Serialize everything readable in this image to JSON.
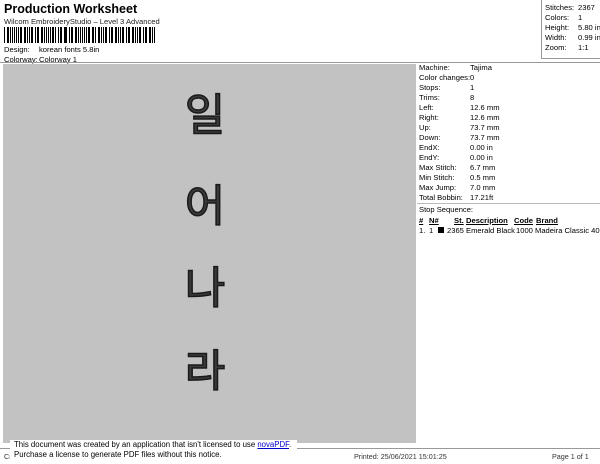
{
  "header": {
    "title": "Production Worksheet",
    "subtitle": "Wilcom EmbroideryStudio – Level 3 Advanced",
    "design_label": "Design:",
    "design_value": "korean fonts 5.8in",
    "colorway_label": "Colorway:",
    "colorway_value": "Colorway 1"
  },
  "stats": [
    {
      "label": "Stitches:",
      "value": "2367"
    },
    {
      "label": "Colors:",
      "value": "1"
    },
    {
      "label": "Height:",
      "value": "5.80 in"
    },
    {
      "label": "Width:",
      "value": "0.99 in"
    },
    {
      "label": "Zoom:",
      "value": "1:1"
    }
  ],
  "design": {
    "characters": [
      "일",
      "어",
      "나",
      "라"
    ],
    "stitch_color": "#1a1a1a",
    "background_color": "#c2c2c2"
  },
  "machine_info": [
    {
      "label": "Machine:",
      "value": "Tajima"
    },
    {
      "label": "Color changes:",
      "value": "0"
    },
    {
      "label": "Stops:",
      "value": "1"
    },
    {
      "label": "Trims:",
      "value": "8"
    },
    {
      "label": "Left:",
      "value": "12.6 mm"
    },
    {
      "label": "Right:",
      "value": "12.6 mm"
    },
    {
      "label": "Up:",
      "value": "73.7 mm"
    },
    {
      "label": "Down:",
      "value": "73.7 mm"
    },
    {
      "label": "EndX:",
      "value": "0.00 in"
    },
    {
      "label": "EndY:",
      "value": "0.00 in"
    },
    {
      "label": "Max Stitch:",
      "value": "6.7 mm"
    },
    {
      "label": "Min Stitch:",
      "value": "0.5 mm"
    },
    {
      "label": "Max Jump:",
      "value": "7.0 mm"
    },
    {
      "label": "Total Bobbin:",
      "value": "17.21ft"
    }
  ],
  "stop_sequence": {
    "title": "Stop Sequence:",
    "headers": [
      "#",
      "N#",
      "St.",
      "Description",
      "Code",
      "Brand"
    ],
    "rows": [
      {
        "num": "1.",
        "n": "1",
        "st": "2365",
        "description": "Emerald Black",
        "code": "1000",
        "brand": "Madeira Classic 40",
        "color": "#000000"
      }
    ]
  },
  "footer": {
    "left": "Cr",
    "printed": "Printed: 25/06/2021 15:01:25",
    "page": "Page 1 of 1"
  },
  "notice": {
    "line1_prefix": "This document was created by an application that isn't licensed to use ",
    "link": "novaPDF",
    "line1_suffix": ".",
    "line2": "Purchase a license to generate PDF files without this notice."
  }
}
